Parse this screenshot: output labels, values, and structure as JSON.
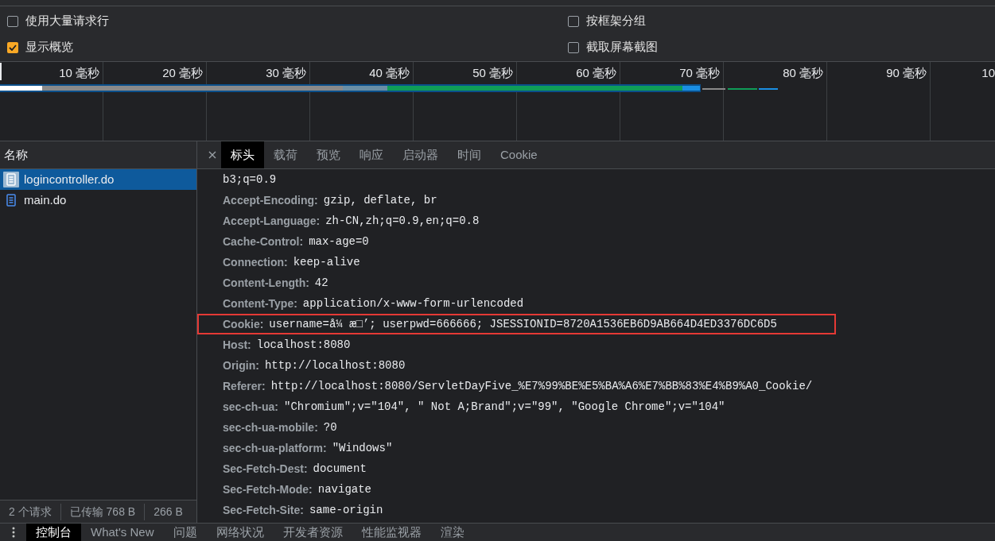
{
  "settings": [
    {
      "label": "使用大量请求行",
      "checked": false
    },
    {
      "label": "按框架分组",
      "checked": false
    },
    {
      "label": "显示概览",
      "checked": true
    },
    {
      "label": "截取屏幕截图",
      "checked": false
    }
  ],
  "overview": {
    "ticks": [
      "10 毫秒",
      "20 毫秒",
      "30 毫秒",
      "40 毫秒",
      "50 毫秒",
      "60 毫秒",
      "70 毫秒",
      "80 毫秒",
      "90 毫秒",
      "10"
    ]
  },
  "requests": {
    "column_header": "名称",
    "items": [
      {
        "name": "logincontroller.do",
        "selected": true
      },
      {
        "name": "main.do",
        "selected": false
      }
    ]
  },
  "summary": [
    "2 个请求",
    "已传输 768 B",
    "266 B"
  ],
  "detail_tabs": [
    {
      "label": "标头",
      "selected": true
    },
    {
      "label": "载荷",
      "selected": false
    },
    {
      "label": "预览",
      "selected": false
    },
    {
      "label": "响应",
      "selected": false
    },
    {
      "label": "启动器",
      "selected": false
    },
    {
      "label": "时间",
      "selected": false
    },
    {
      "label": "Cookie",
      "selected": false
    }
  ],
  "headers": [
    {
      "value": "b3;q=0.9",
      "highlighted": false
    },
    {
      "name": "Accept-Encoding:",
      "value": "gzip, deflate, br",
      "highlighted": false
    },
    {
      "name": "Accept-Language:",
      "value": "zh-CN,zh;q=0.9,en;q=0.8",
      "highlighted": false
    },
    {
      "name": "Cache-Control:",
      "value": "max-age=0",
      "highlighted": false
    },
    {
      "name": "Connection:",
      "value": "keep-alive",
      "highlighted": false
    },
    {
      "name": "Content-Length:",
      "value": "42",
      "highlighted": false
    },
    {
      "name": "Content-Type:",
      "value": "application/x-www-form-urlencoded",
      "highlighted": false
    },
    {
      "name": "Cookie:",
      "value": "username=å¼ æ□’; userpwd=666666; JSESSIONID=8720A1536EB6D9AB664D4ED3376DC6D5",
      "highlighted": true
    },
    {
      "name": "Host:",
      "value": "localhost:8080",
      "highlighted": false
    },
    {
      "name": "Origin:",
      "value": "http://localhost:8080",
      "highlighted": false
    },
    {
      "name": "Referer:",
      "value": "http://localhost:8080/ServletDayFive_%E7%99%BE%E5%BA%A6%E7%BB%83%E4%B9%A0_Cookie/",
      "highlighted": false
    },
    {
      "name": "sec-ch-ua:",
      "value": "\"Chromium\";v=\"104\", \" Not A;Brand\";v=\"99\", \"Google Chrome\";v=\"104\"",
      "highlighted": false
    },
    {
      "name": "sec-ch-ua-mobile:",
      "value": "?0",
      "highlighted": false
    },
    {
      "name": "sec-ch-ua-platform:",
      "value": "\"Windows\"",
      "highlighted": false
    },
    {
      "name": "Sec-Fetch-Dest:",
      "value": "document",
      "highlighted": false
    },
    {
      "name": "Sec-Fetch-Mode:",
      "value": "navigate",
      "highlighted": false
    },
    {
      "name": "Sec-Fetch-Site:",
      "value": "same-origin",
      "highlighted": false
    }
  ],
  "drawer_tabs": [
    {
      "label": "控制台",
      "selected": true
    },
    {
      "label": "What's New",
      "selected": false
    },
    {
      "label": "问题",
      "selected": false
    },
    {
      "label": "网络状况",
      "selected": false
    },
    {
      "label": "开发者资源",
      "selected": false
    },
    {
      "label": "性能监视器",
      "selected": false
    },
    {
      "label": "渲染",
      "selected": false
    }
  ]
}
